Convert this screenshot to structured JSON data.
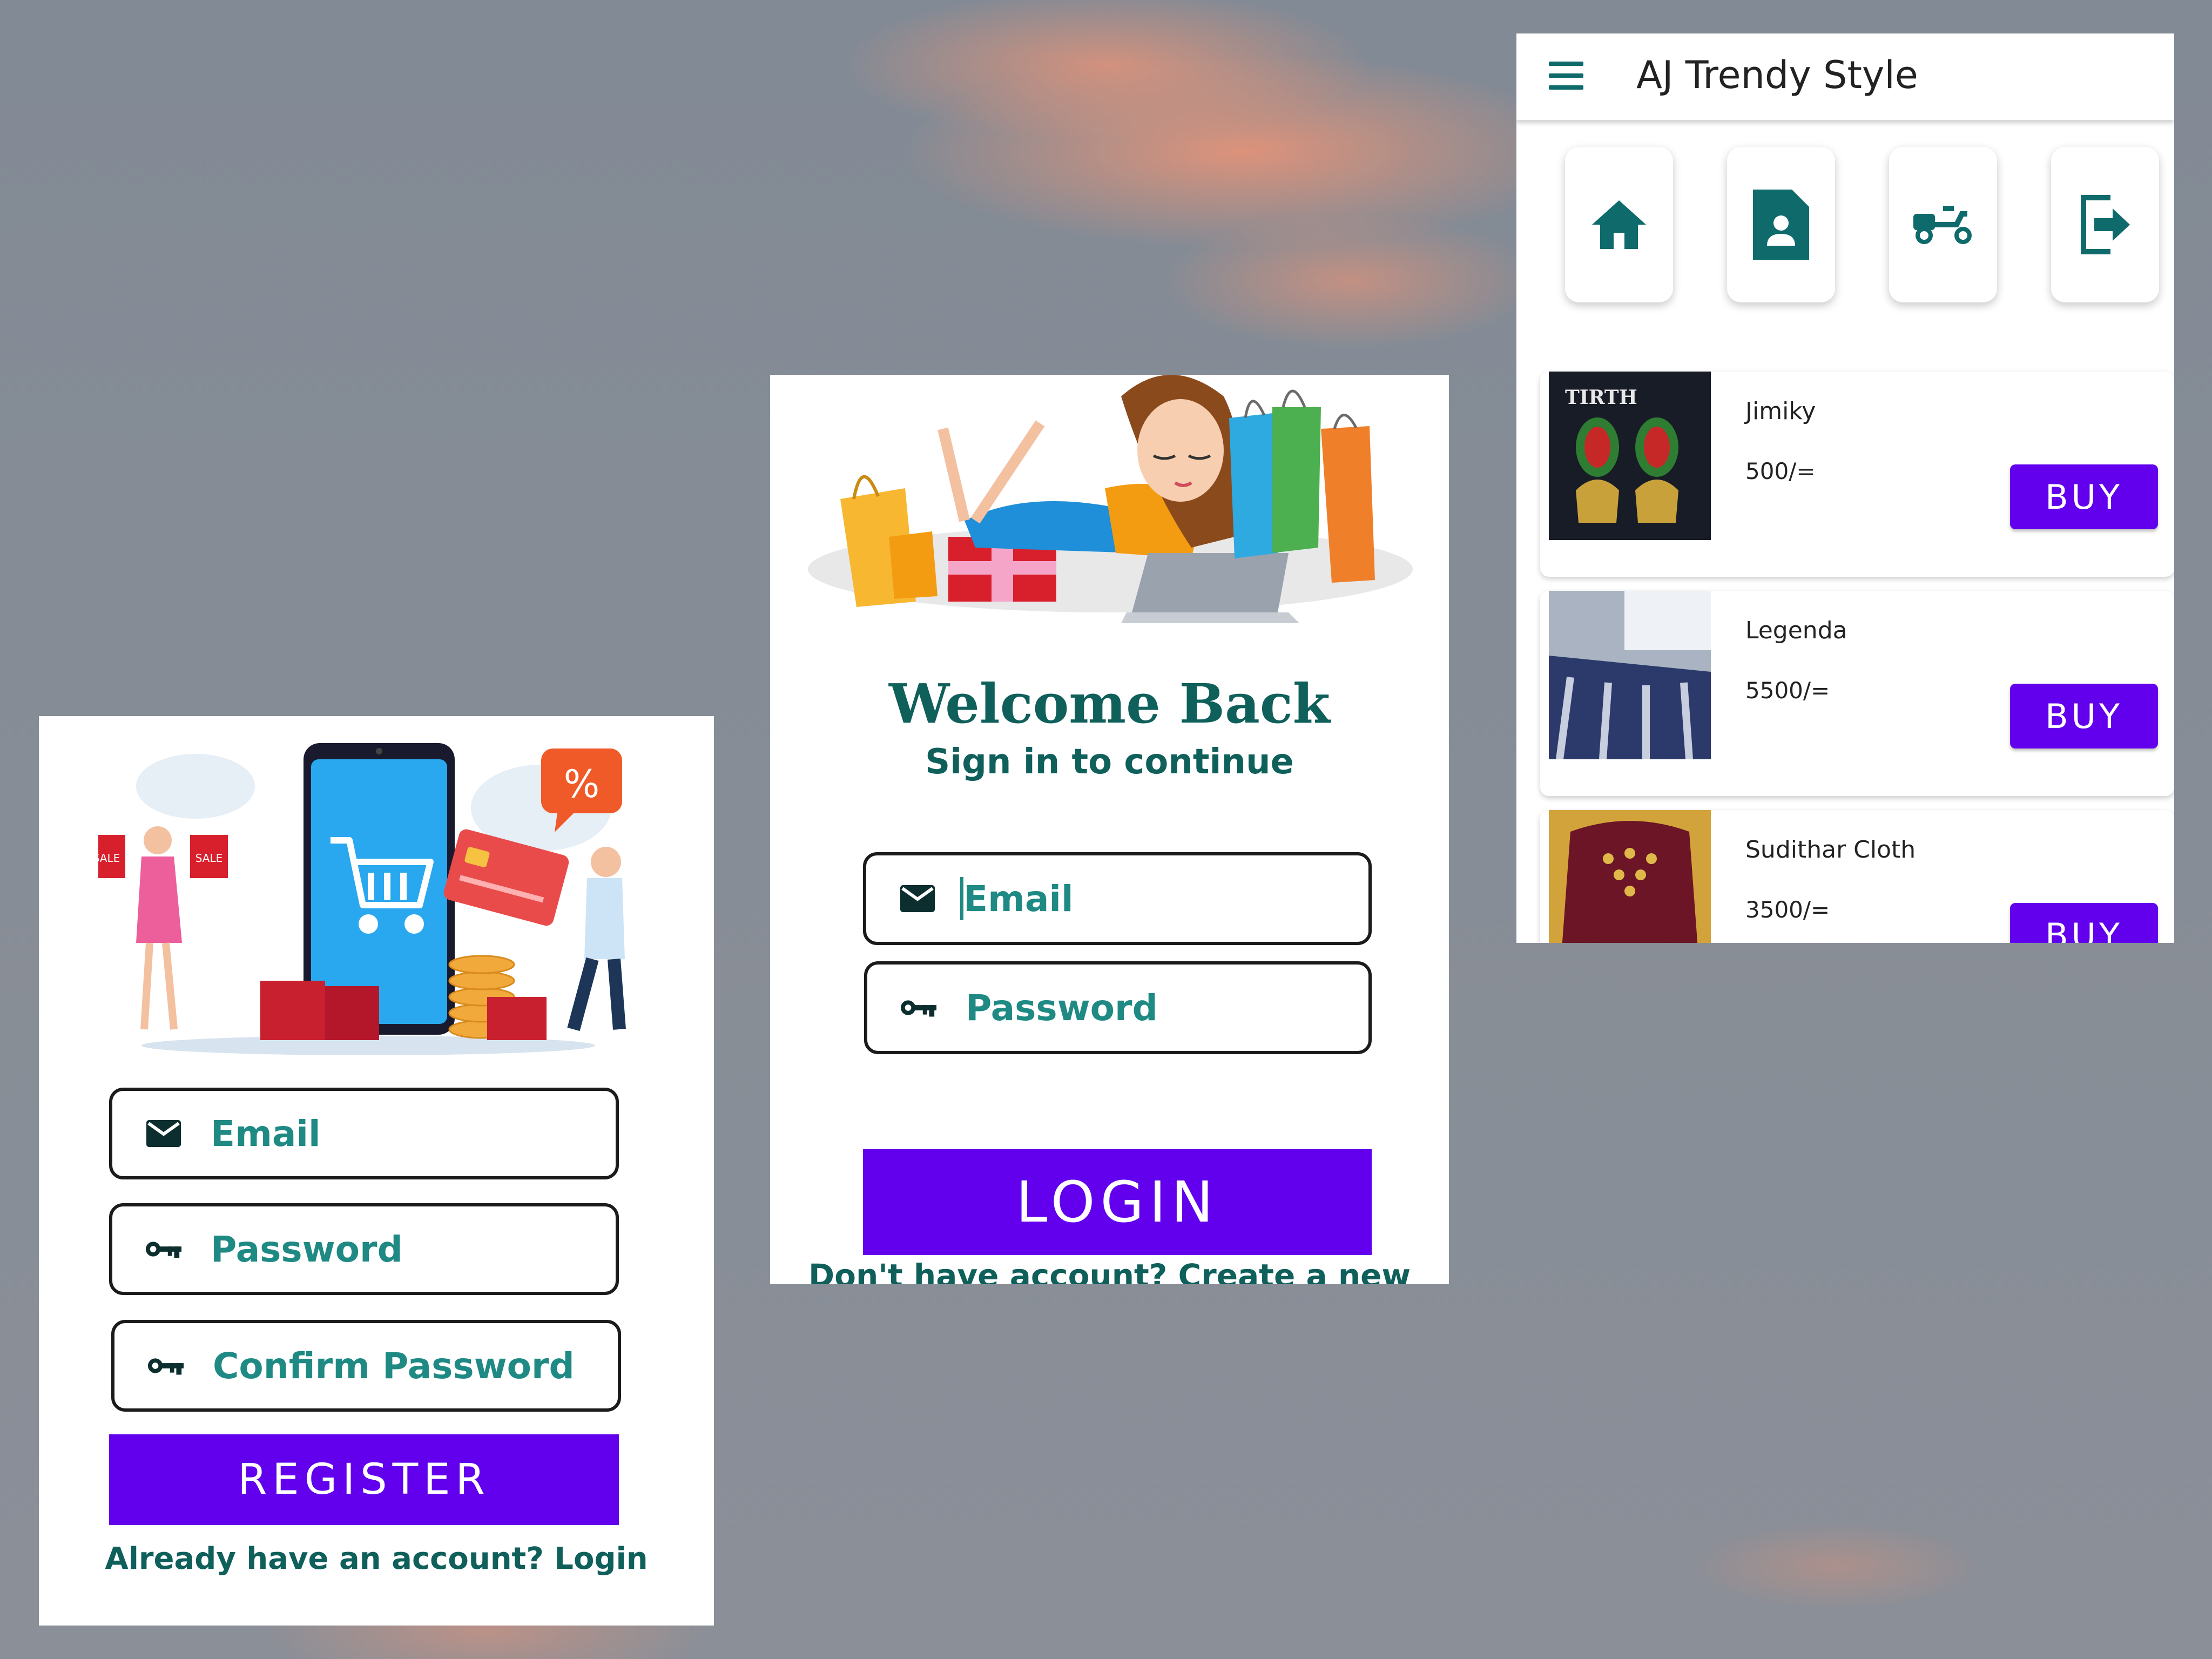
{
  "register": {
    "email_label": "Email",
    "password_label": "Password",
    "confirm_password_label": "Confirm Password",
    "register_button": "REGISTER",
    "login_link": "Already have an account? Login"
  },
  "login": {
    "title": "Welcome Back",
    "subtitle": "Sign in to continue",
    "email_label": "Email",
    "password_label": "Password",
    "login_button": "LOGIN",
    "create_account_link": "Don't have account? Create a new account"
  },
  "home": {
    "app_title": "AJ Trendy Style",
    "nav": [
      {
        "icon": "home-icon"
      },
      {
        "icon": "profile-icon"
      },
      {
        "icon": "delivery-icon"
      },
      {
        "icon": "logout-icon"
      }
    ],
    "products": [
      {
        "name": "Jimiky",
        "price": "500/=",
        "buy": "BUY"
      },
      {
        "name": "Legenda",
        "price": "5500/=",
        "buy": "BUY"
      },
      {
        "name": "Sudithar Cloth",
        "price": "3500/=",
        "buy": "BUY"
      }
    ],
    "thumb_text": "TIRTH"
  },
  "colors": {
    "primary": "#6200ee",
    "teal_text": "#1f8a84",
    "dark_teal": "#0f5f5b",
    "icon_teal": "#0f6b6b"
  }
}
